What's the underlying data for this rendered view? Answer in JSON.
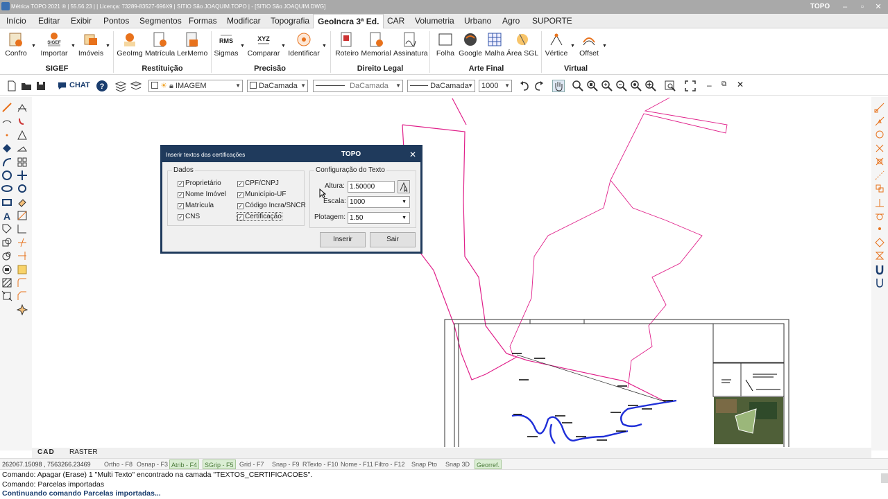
{
  "window": {
    "title": "Métrica TOPO 2021 ® | 55.56.23 | | Licença: 73289-83527-696X9 | SITIO São JOAQUIM.TOPO | - [SITIO São JOAQUIM.DWG]",
    "logo": "TOPO"
  },
  "menu": [
    "Início",
    "Editar",
    "Exibir",
    "Pontos",
    "Segmentos",
    "Formas",
    "Modificar",
    "Topografia",
    "GeoIncra 3ª Ed.",
    "CAR",
    "Volumetria",
    "Urbano",
    "Agro",
    "SUPORTE"
  ],
  "ribbon": {
    "buttons": [
      "Confro",
      "Importar",
      "Imóveis",
      "GeoImg",
      "Matrícula",
      "LerMemo",
      "Sigmas",
      "Comparar",
      "Identificar",
      "Roteiro",
      "Memorial",
      "Assinatura",
      "Folha",
      "Google",
      "Malha",
      "Área SGL",
      "Vértice",
      "Offset"
    ],
    "groups": [
      "SIGEF",
      "Restituição",
      "Precisão",
      "Direito Legal",
      "Arte Final",
      "Virtual"
    ],
    "icon_texts": {
      "sigef": "SIGEF",
      "rms": "RMS",
      "xyz": "XYZ"
    }
  },
  "toolbar": {
    "chat_label": "CHAT",
    "layer_combo": "IMAGEM",
    "color_combo": "DaCamada",
    "linetype_combo": "DaCamada",
    "lineweight_combo": "DaCamada",
    "scale_combo": "1000"
  },
  "dialog": {
    "title": "Inserir textos das certificações",
    "logo": "TOPO",
    "dados_legend": "Dados",
    "checkboxes": [
      "Proprietário",
      "Nome Imóvel",
      "Matrícula",
      "CNS",
      "CPF/CNPJ",
      "Município-UF",
      "Código Incra/SNCR",
      "Certificação"
    ],
    "config_legend": "Configuração do Texto",
    "altura_label": "Altura:",
    "altura_value": "1.50000",
    "escala_label": "Escala:",
    "escala_value": "1000",
    "plotagem_label": "Plotagem:",
    "plotagem_value": "1.50",
    "insert_button": "Inserir",
    "exit_button": "Sair"
  },
  "bottom_tabs": [
    "CAD",
    "RASTER"
  ],
  "status": {
    "coords": "262067.15098 , 7563266.23469",
    "toggles": [
      "Ortho - F8",
      "Osnap - F3",
      "Atrib - F4",
      "SGrip - F5",
      "Grid - F7",
      "Snap - F9",
      "RTexto - F10",
      "Nome - F11",
      "Filtro - F12",
      "Snap Pto",
      "Snap 3D",
      "Georref."
    ]
  },
  "command_lines": [
    "Comando: Apagar (Erase) 1 \"Multi Texto\" encontrado na camada \"TEXTOS_CERTIFICACOES\".",
    "Comando: Parcelas importadas",
    "Continuando comando Parcelas importadas..."
  ],
  "colors": {
    "pink_line": "#e0208a",
    "blue_line": "#1f2fd8",
    "dialog_frame": "#1f3a5c",
    "title_bar": "#a9a9a9"
  }
}
